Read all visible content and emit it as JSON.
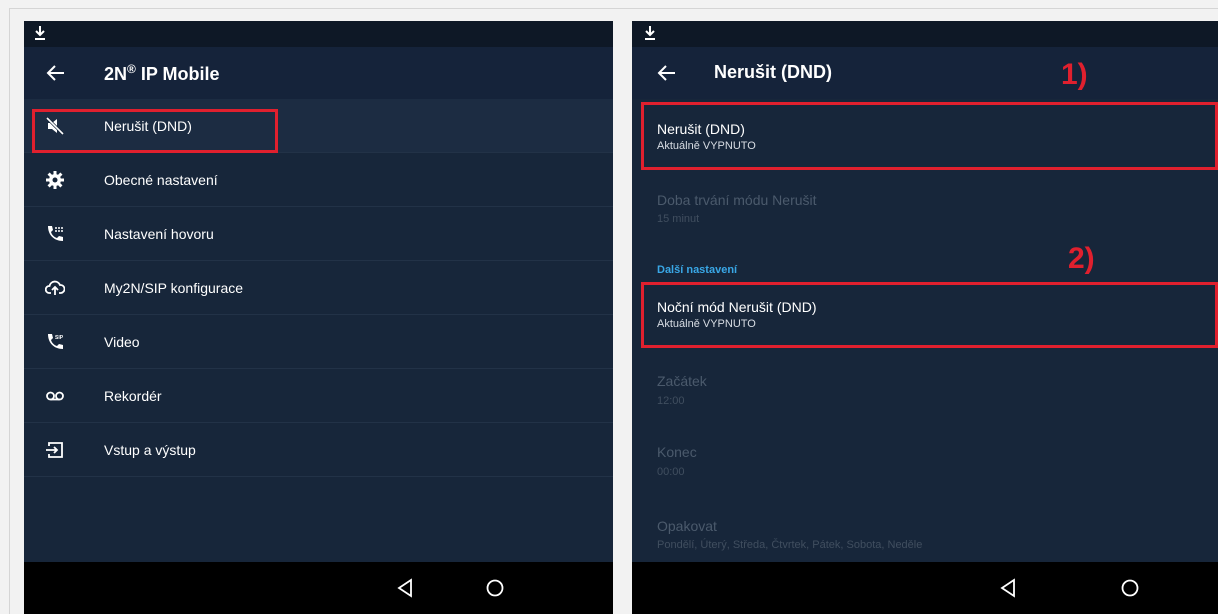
{
  "left_panel": {
    "app_title": "2N",
    "app_title_sup": "®",
    "app_title_rest": " IP Mobile",
    "menu_items": [
      {
        "label": "Nerušit (DND)",
        "icon": "do-not-disturb-icon"
      },
      {
        "label": "Obecné nastavení",
        "icon": "gear-icon"
      },
      {
        "label": "Nastavení hovoru",
        "icon": "phone-dialpad-icon"
      },
      {
        "label": "My2N/SIP konfigurace",
        "icon": "cloud-sync-icon"
      },
      {
        "label": "Video",
        "icon": "sip-phone-icon"
      },
      {
        "label": "Rekordér",
        "icon": "voicemail-icon"
      },
      {
        "label": "Vstup a výstup",
        "icon": "input-output-icon"
      }
    ]
  },
  "right_panel": {
    "title": "Nerušit (DND)",
    "prefs": [
      {
        "title": "Nerušit (DND)",
        "subtitle": "Aktuálně VYPNUTO",
        "enabled": true
      },
      {
        "title": "Doba trvání módu Nerušit",
        "subtitle": "15 minut",
        "enabled": false
      },
      {
        "title": "Noční mód Nerušit (DND)",
        "subtitle": "Aktuálně VYPNUTO",
        "enabled": true
      },
      {
        "title": "Začátek",
        "subtitle": "12:00",
        "enabled": false
      },
      {
        "title": "Konec",
        "subtitle": "00:00",
        "enabled": false
      },
      {
        "title": "Opakovat",
        "subtitle": "Pondělí, Úterý, Středa, Čtvrtek, Pátek, Sobota, Neděle",
        "enabled": false
      }
    ],
    "section_header": "Další nastavení"
  },
  "annotations": {
    "label_1": "1)",
    "label_2": "2)",
    "color": "#e0202e"
  },
  "colors": {
    "panel_bg": "#17263a",
    "appbar_bg": "#15233a",
    "accent": "#39a7e6"
  }
}
